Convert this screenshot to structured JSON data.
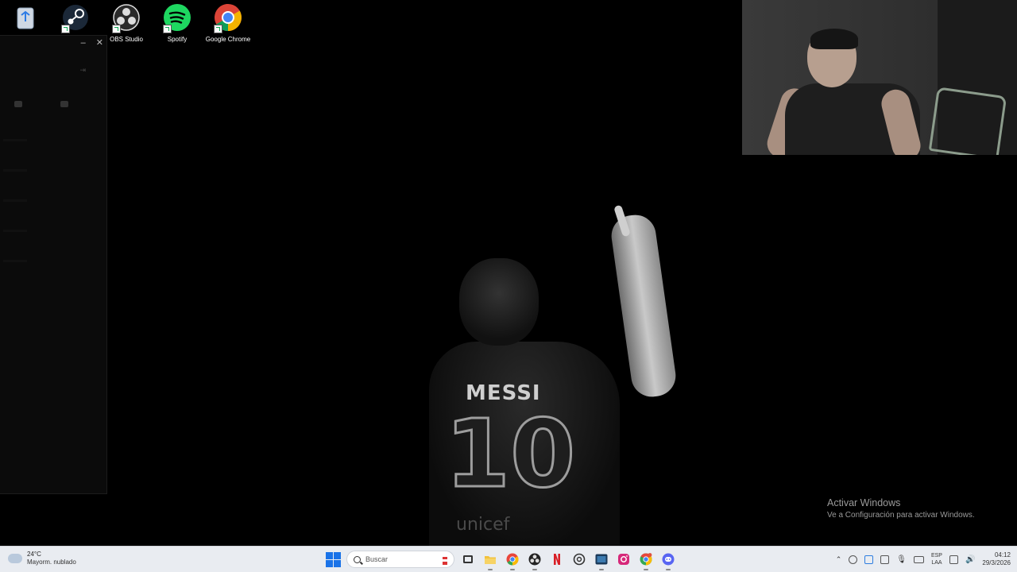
{
  "desktop": {
    "icons": [
      {
        "name": "recycle-bin-icon",
        "label": ""
      },
      {
        "name": "steam-icon",
        "label": ""
      },
      {
        "name": "obs-studio-icon",
        "label": "OBS Studio"
      },
      {
        "name": "spotify-icon",
        "label": "Spotify"
      },
      {
        "name": "google-chrome-icon",
        "label": "Google Chrome"
      }
    ]
  },
  "side_panel": {
    "minimize": "–",
    "close": "✕",
    "collapse": "⇥"
  },
  "wallpaper": {
    "player_name": "MESSI",
    "number": "10",
    "sponsor": "unicef"
  },
  "watermark": {
    "title": "Activar Windows",
    "subtitle": "Ve a Configuración para activar Windows."
  },
  "taskbar": {
    "weather": {
      "temp": "24°C",
      "condition": "Mayorm. nublado"
    },
    "search_placeholder": "Buscar",
    "apps": [
      {
        "name": "file-explorer-icon",
        "color": "#f2c23c"
      },
      {
        "name": "chrome-taskbar-icon",
        "color": "#e9453a"
      },
      {
        "name": "obs-taskbar-icon",
        "color": "#222222"
      },
      {
        "name": "netflix-icon",
        "color": "#d81f26"
      },
      {
        "name": "chatgpt-icon",
        "color": "#333333"
      },
      {
        "name": "steam-taskbar-icon",
        "color": "#1b3a5a"
      },
      {
        "name": "instagram-icon",
        "color": "#d6297a"
      },
      {
        "name": "chrome-profile-icon",
        "color": "#34a853"
      },
      {
        "name": "discord-icon",
        "color": "#5865f2"
      }
    ],
    "language": {
      "code": "ESP",
      "layout": "LAA"
    },
    "clock": {
      "time": "04:12",
      "date": "29/3/2026"
    }
  }
}
